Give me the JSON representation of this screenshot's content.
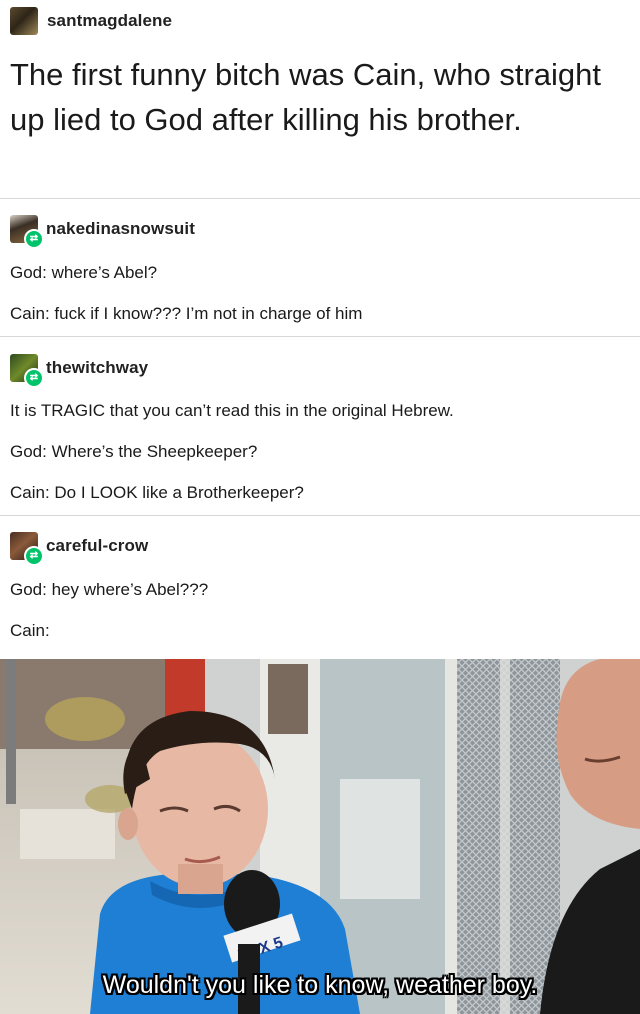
{
  "post": {
    "username": "santmagdalene",
    "text": "The first funny bitch was Cain, who straight up lied to God after killing his brother."
  },
  "reblogs": [
    {
      "username": "nakedinasnowsuit",
      "lines": [
        "God: where’s Abel?",
        "Cain: fuck if I know??? I’m not in charge of him"
      ]
    },
    {
      "username": "thewitchway",
      "lines": [
        "It is TRAGIC that you can’t read this in the original Hebrew.",
        "God:  Where’s the Sheepkeeper?",
        "Cain: Do I LOOK like a Brotherkeeper?"
      ]
    },
    {
      "username": "careful-crow",
      "lines": [
        "God: hey where’s Abel???",
        "Cain:"
      ]
    }
  ],
  "meme": {
    "caption": "Wouldn't you like to know, weather boy.",
    "mic_logo": "FOX 5"
  },
  "colors": {
    "reblog_badge": "#00c46a",
    "divider": "#d8d8d8",
    "shirt": "#1e7fd4"
  }
}
